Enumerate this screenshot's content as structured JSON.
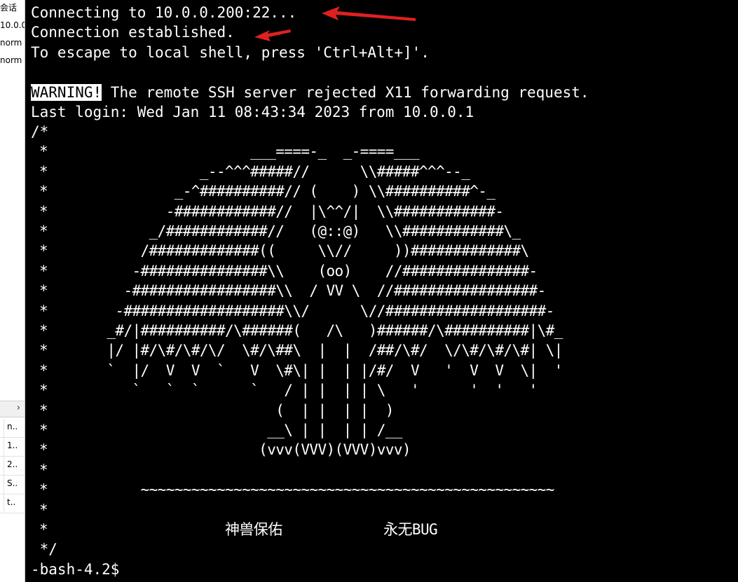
{
  "sidebar": {
    "top_items": [
      "会话",
      "10.0.0",
      "norm",
      "norm"
    ],
    "list_items": [
      "n..",
      "1..",
      "2..",
      "S..",
      "t.."
    ],
    "toolbar_icon": "chevron-right-icon"
  },
  "terminal": {
    "lines": [
      "Connecting to 10.0.0.200:22...",
      "Connection established.",
      "To escape to local shell, press 'Ctrl+Alt+]'.",
      "",
      "",
      "Last login: Wed Jan 11 08:43:34 2023 from 10.0.0.1",
      "/*",
      " *                        ___====-_  _-====___",
      " *                  _--^^^#####//      \\\\#####^^^--_",
      " *               _-^##########// (    ) \\\\##########^-_",
      " *              -############//  |\\^^/|  \\\\############-",
      " *            _/############//   (@::@)   \\\\############\\_",
      " *           /#############((     \\\\//     ))#############\\",
      " *          -###############\\\\    (oo)    //###############-",
      " *         -#################\\\\  / VV \\  //#################-",
      " *        -###################\\\\/      \\//###################-",
      " *       _#/|##########/\\######(   /\\   )######/\\##########|\\#_",
      " *       |/ |#/\\#/\\#/\\/  \\#/\\##\\  |  |  /##/\\#/  \\/\\#/\\#/\\#| \\|",
      " *       `  |/  V  V  `   V  \\#\\| |  | |/#/  V   '  V  V  \\|  '",
      " *          `   `  `      `   / | |  | | \\   '      '  '   '",
      " *                           (  | |  | |  )",
      " *                          __\\ | |  | | /__",
      " *                         (vvv(VVV)(VVV)vvv)",
      " *",
      " *           ~~~~~~~~~~~~~~~~~~~~~~~~~~~~~~~~~~~~~~~~~~~~~~~~~",
      " *",
      " *                     神兽保佑            永无BUG",
      " */",
      "-bash-4.2$"
    ],
    "warning_label": "WARNING!",
    "warning_rest": " The remote SSH server rejected X11 forwarding request."
  },
  "annotations": {
    "arrow_color": "#e02020"
  }
}
